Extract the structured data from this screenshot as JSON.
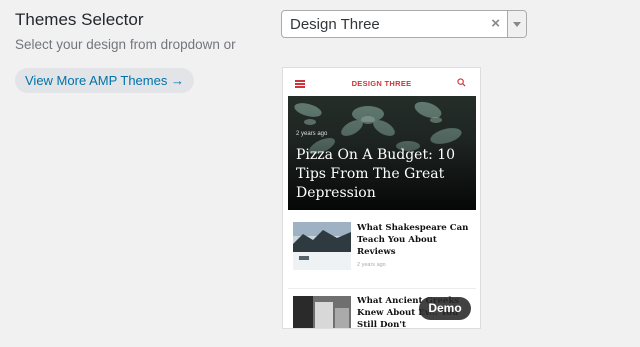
{
  "header": {
    "title": "Themes Selector",
    "subtitle": "Select your design from dropdown or"
  },
  "more_themes_link": {
    "label": "View More AMP Themes →"
  },
  "theme_select": {
    "selected_value": "Design Three",
    "clear_symbol": "×"
  },
  "preview": {
    "brand": "DESIGN THREE",
    "brand_color": "#d0343a",
    "hero": {
      "meta": "2 years ago",
      "headline": "Pizza On A Budget: 10 Tips From The Great Depression"
    },
    "articles": [
      {
        "title": "What Shakespeare Can Teach You About Reviews",
        "meta": "2 years ago"
      },
      {
        "title": "What Ancient Greeks Knew About Ev... You Still Don't"
      }
    ],
    "demo_label": "Demo"
  }
}
